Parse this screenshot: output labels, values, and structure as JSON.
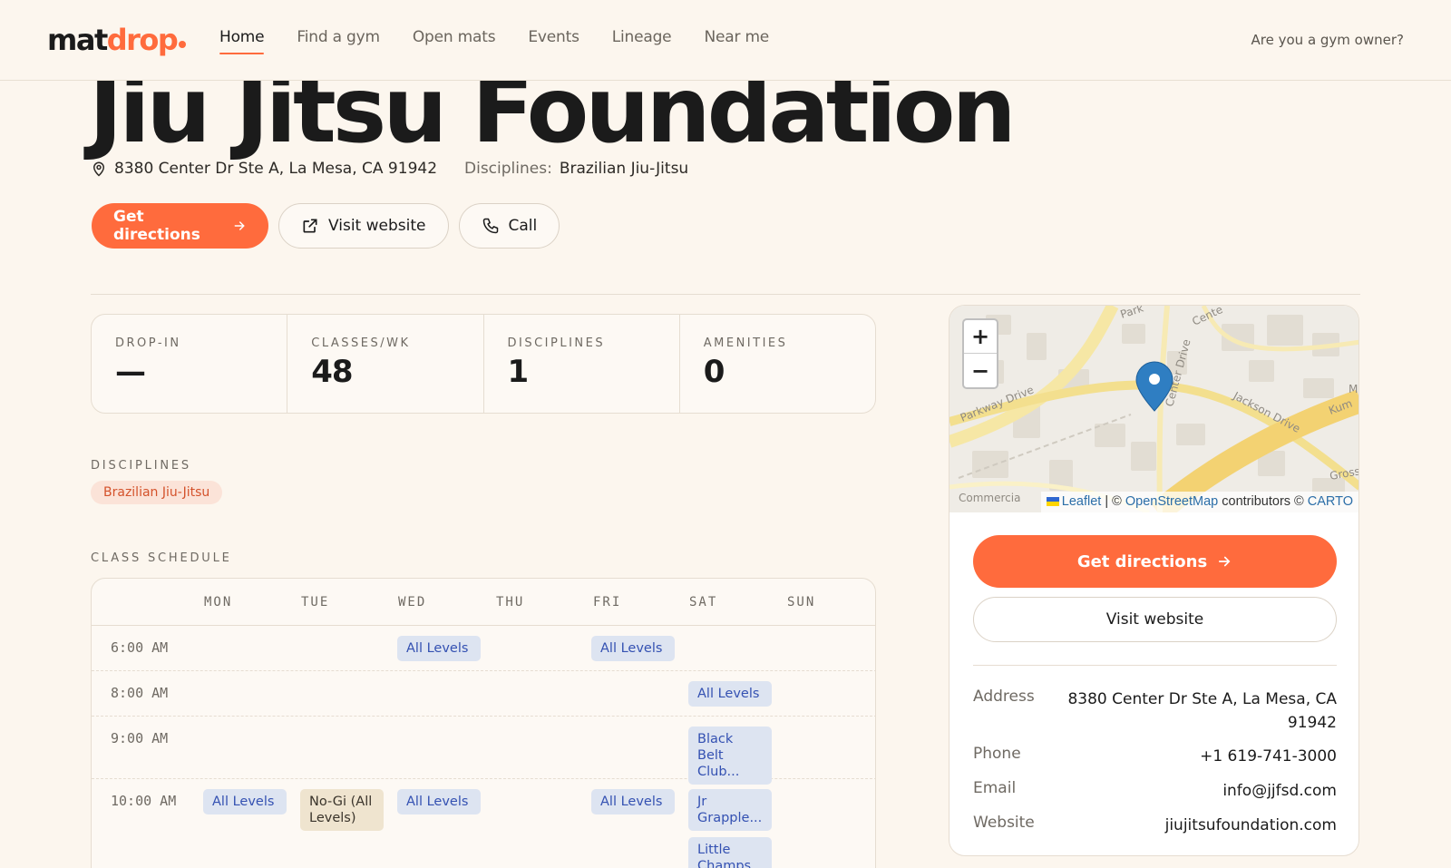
{
  "header": {
    "logo_part1": "mat",
    "logo_part2": "drop",
    "nav": [
      "Home",
      "Find a gym",
      "Open mats",
      "Events",
      "Lineage",
      "Near me"
    ],
    "owner_link": "Are you a gym owner?"
  },
  "gym": {
    "name": "Jiu Jitsu Foundation",
    "address": "8380 Center Dr Ste A, La Mesa, CA 91942",
    "disciplines_label": "Disciplines:",
    "disciplines_value": "Brazilian Jiu-Jitsu"
  },
  "actions": {
    "directions": "Get directions",
    "website": "Visit website",
    "call": "Call"
  },
  "stats": [
    {
      "label": "DROP-IN",
      "value": "—"
    },
    {
      "label": "CLASSES/WK",
      "value": "48"
    },
    {
      "label": "DISCIPLINES",
      "value": "1"
    },
    {
      "label": "AMENITIES",
      "value": "0"
    }
  ],
  "disciplines_section": {
    "label": "DISCIPLINES",
    "tags": [
      "Brazilian Jiu-Jitsu"
    ]
  },
  "schedule": {
    "label": "CLASS SCHEDULE",
    "days": [
      "MON",
      "TUE",
      "WED",
      "THU",
      "FRI",
      "SAT",
      "SUN"
    ],
    "rows": [
      {
        "time": "6:00 AM",
        "classes": {
          "WED": [
            "All Levels"
          ],
          "FRI": [
            "All Levels"
          ]
        }
      },
      {
        "time": "8:00 AM",
        "classes": {
          "SAT": [
            "All Levels"
          ]
        }
      },
      {
        "time": "9:00 AM",
        "classes": {
          "SAT": [
            "Black Belt Club..."
          ]
        }
      },
      {
        "time": "10:00 AM",
        "classes": {
          "MON": [
            "All Levels"
          ],
          "TUE": [
            "No-Gi (All Levels)"
          ],
          "WED": [
            "All Levels"
          ],
          "FRI": [
            "All Levels"
          ],
          "SAT": [
            "Jr Grapple...",
            "Little Champs..."
          ]
        }
      }
    ]
  },
  "map": {
    "zoom_in": "+",
    "zoom_out": "−",
    "streets": [
      "Park",
      "Cente",
      "Center Drive",
      "Parkway Drive",
      "Jackson Drive",
      "Kum",
      "M",
      "Grossm",
      "Commercia"
    ],
    "attribution": {
      "leaflet": "Leaflet",
      "sep": " | © ",
      "osm": "OpenStreetMap",
      "contrib": " contributors © ",
      "carto": "CARTO"
    }
  },
  "sidebar": {
    "directions": "Get directions",
    "website": "Visit website",
    "info": [
      {
        "label": "Address",
        "value": "8380 Center Dr Ste A, La Mesa, CA 91942"
      },
      {
        "label": "Phone",
        "value": "+1 619-741-3000"
      },
      {
        "label": "Email",
        "value": "info@jjfsd.com"
      },
      {
        "label": "Website",
        "value": "jiujitsufoundation.com"
      }
    ]
  },
  "colors": {
    "accent": "#ff6b3d",
    "background": "#fcf6ee",
    "class_chip": "#dde4f1",
    "class_chip_text": "#3451b2"
  }
}
